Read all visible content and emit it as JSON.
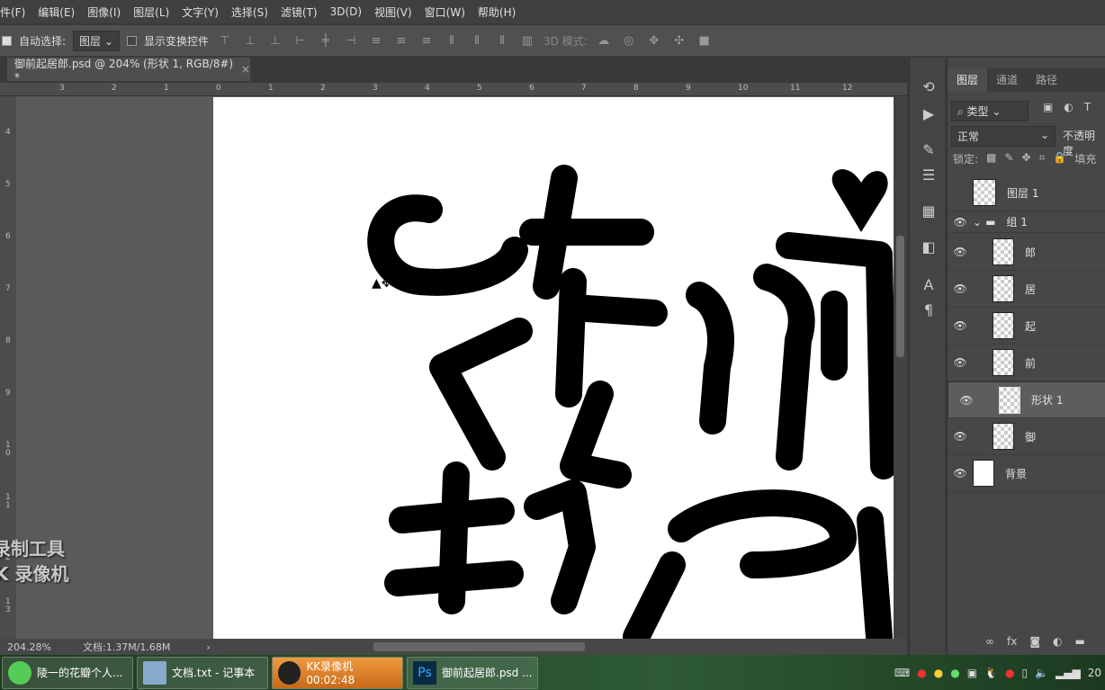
{
  "menu": [
    "件(F)",
    "编辑(E)",
    "图像(I)",
    "图层(L)",
    "文字(Y)",
    "选择(S)",
    "滤镜(T)",
    "3D(D)",
    "视图(V)",
    "窗口(W)",
    "帮助(H)"
  ],
  "options": {
    "auto_select_label": "自动选择:",
    "auto_select_checked": true,
    "auto_select_value": "图层",
    "show_transform_label": "显示变换控件",
    "mode_3d_label": "3D 模式:"
  },
  "document": {
    "tab_title": "御前起居郎.psd @ 204% (形状 1, RGB/8#) *",
    "close": "×",
    "zoom": "204.28%",
    "doc_info": "文档:1.37M/1.68M"
  },
  "rulers": {
    "h": [
      "3",
      "2",
      "1",
      "0",
      "1",
      "2",
      "3",
      "4",
      "5",
      "6",
      "7",
      "8",
      "9",
      "10",
      "11",
      "12"
    ],
    "v": [
      "4",
      "5",
      "6",
      "7",
      "8",
      "9",
      "1 0",
      "1 1",
      "1 2",
      "1 3"
    ]
  },
  "layers_panel": {
    "tabs": [
      "图层",
      "通道",
      "路径"
    ],
    "filter_kind": "类型",
    "blend_mode": "正常",
    "opacity_label": "不透明度",
    "lock_label": "锁定:",
    "fill_label": "填充",
    "layers": [
      {
        "name": "图层 1",
        "visible": false
      },
      {
        "name": "组 1",
        "visible": true,
        "group": true
      },
      {
        "name": "郎",
        "visible": true
      },
      {
        "name": "居",
        "visible": true
      },
      {
        "name": "起",
        "visible": true
      },
      {
        "name": "前",
        "visible": true
      },
      {
        "name": "形状 1",
        "visible": true,
        "selected": true
      },
      {
        "name": "御",
        "visible": true
      },
      {
        "name": "背景",
        "visible": true
      }
    ]
  },
  "watermark": [
    "录制工具",
    "K 录像机"
  ],
  "taskbar": {
    "items": [
      "陵一的花瓣个人...",
      "文档.txt - 记事本",
      "KK录像机 00:02:48",
      "御前起居郎.psd ..."
    ],
    "clock": "20"
  }
}
